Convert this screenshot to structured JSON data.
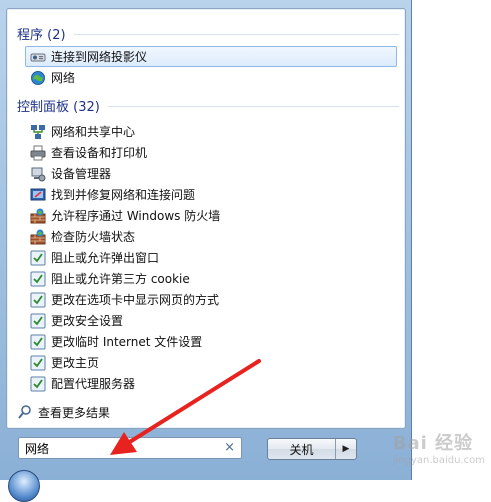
{
  "programs": {
    "header": "程序 (2)",
    "items": [
      {
        "label": "连接到网络投影仪",
        "icon": "projector-icon",
        "selected": true
      },
      {
        "label": "网络",
        "icon": "network-globe-icon",
        "selected": false
      }
    ]
  },
  "control_panel": {
    "header": "控制面板 (32)",
    "items": [
      {
        "label": "网络和共享中心",
        "icon": "network-sharing-icon"
      },
      {
        "label": "查看设备和打印机",
        "icon": "printer-icon"
      },
      {
        "label": "设备管理器",
        "icon": "device-manager-icon"
      },
      {
        "label": "找到并修复网络和连接问题",
        "icon": "troubleshoot-icon"
      },
      {
        "label": "允许程序通过 Windows 防火墙",
        "icon": "firewall-icon"
      },
      {
        "label": "检查防火墙状态",
        "icon": "firewall-icon"
      },
      {
        "label": "阻止或允许弹出窗口",
        "icon": "internet-options-icon"
      },
      {
        "label": "阻止或允许第三方 cookie",
        "icon": "internet-options-icon"
      },
      {
        "label": "更改在选项卡中显示网页的方式",
        "icon": "internet-options-icon"
      },
      {
        "label": "更改安全设置",
        "icon": "internet-options-icon"
      },
      {
        "label": "更改临时 Internet 文件设置",
        "icon": "internet-options-icon"
      },
      {
        "label": "更改主页",
        "icon": "internet-options-icon"
      },
      {
        "label": "配置代理服务器",
        "icon": "internet-options-icon"
      }
    ]
  },
  "see_more": {
    "label": "查看更多结果",
    "icon": "search-icon"
  },
  "search": {
    "value": "网络",
    "clear_symbol": "×"
  },
  "shutdown": {
    "label": "关机",
    "arrow_symbol": "▶"
  },
  "watermark": {
    "text": "Bai 经验",
    "sub": "jingyan.baidu.com"
  },
  "colors": {
    "header": "#1e3287",
    "arrow": "#e8231f",
    "selection_border": "#8fb8e6"
  }
}
